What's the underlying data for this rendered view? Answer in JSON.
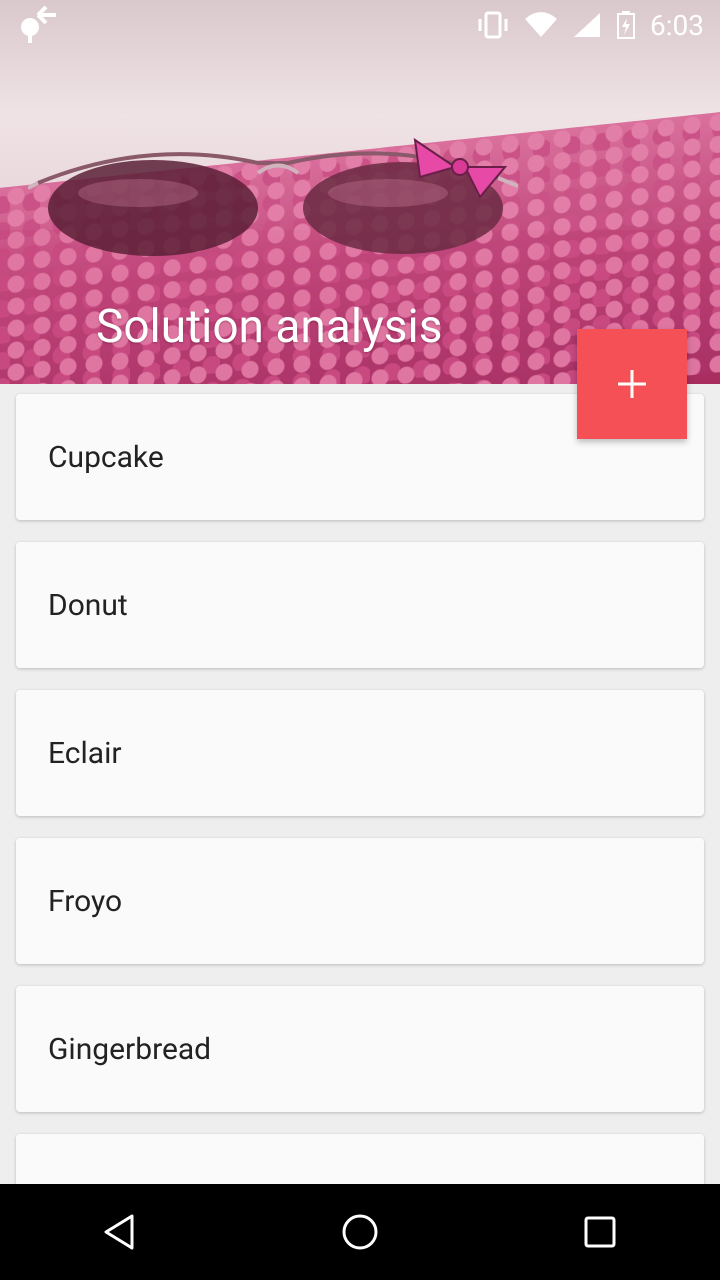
{
  "status_bar": {
    "time": "6:03",
    "icons": [
      "android-debug-icon",
      "vibrate-icon",
      "wifi-icon",
      "signal-icon",
      "battery-charging-icon"
    ]
  },
  "header": {
    "title": "Solution analysis",
    "image_description": "sunglasses-on-pink-carpet"
  },
  "fab": {
    "icon": "plus-icon",
    "color": "#f45056"
  },
  "list": {
    "items": [
      {
        "label": "Cupcake"
      },
      {
        "label": "Donut"
      },
      {
        "label": "Eclair"
      },
      {
        "label": "Froyo"
      },
      {
        "label": "Gingerbread"
      },
      {
        "label": ""
      }
    ]
  },
  "nav_bar": {
    "buttons": [
      "back-icon",
      "home-icon",
      "recents-icon"
    ]
  }
}
